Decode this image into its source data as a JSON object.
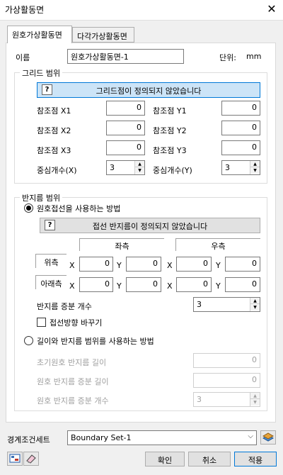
{
  "window": {
    "title": "가상활동면",
    "close_glyph": "✕"
  },
  "tabs": [
    {
      "label": "원호가상활동면",
      "active": true
    },
    {
      "label": "다각가상활동면",
      "active": false
    }
  ],
  "name_row": {
    "label": "이름",
    "value": "원호가상활동면-1",
    "unit_label": "단위:",
    "unit_value": "mm"
  },
  "grid": {
    "group_label": "그리드 범위",
    "banner_text": "그리드점이 정의되지 않았습니다",
    "fields": {
      "x1_label": "참조점 X1",
      "x1_value": "0",
      "y1_label": "참조점 Y1",
      "y1_value": "0",
      "x2_label": "참조점 X2",
      "x2_value": "0",
      "y2_label": "참조점 Y2",
      "y2_value": "0",
      "x3_label": "참조점 X3",
      "x3_value": "0",
      "y3_label": "참조점 Y3",
      "y3_value": "0"
    },
    "center_x_label": "중심개수(X)",
    "center_x_value": "3",
    "center_y_label": "중심개수(Y)",
    "center_y_value": "3"
  },
  "radius": {
    "group_label": "반지름 범위",
    "option1_label": "원호접선을 사용하는 방법",
    "option1_checked": true,
    "banner_text": "접선 반지름이 정의되지 않았습니다",
    "left_header": "좌측",
    "right_header": "우측",
    "upper_label": "위측",
    "lower_label": "아래측",
    "x_letter": "X",
    "y_letter": "Y",
    "upper": {
      "left_x": "0",
      "left_y": "0",
      "right_x": "0",
      "right_y": "0"
    },
    "lower": {
      "left_x": "0",
      "left_y": "0",
      "right_x": "0",
      "right_y": "0"
    },
    "increment_count_label": "반지름 증분 개수",
    "increment_count_value": "3",
    "flip_tangent_label": "접선방향 바꾸기",
    "flip_tangent_checked": false,
    "option2_label": "길이와 반지름 범위를 사용하는 방법",
    "option2_checked": false,
    "initial_radius_label": "초기원호 반지름 길이",
    "initial_radius_value": "0",
    "radius_increment_length_label": "원호 반지름 증분 길이",
    "radius_increment_length_value": "0",
    "radius_increment_count_label": "원호 반지름 증분 개수",
    "radius_increment_count_value": "3"
  },
  "boundary": {
    "label": "경계조건세트",
    "value": "Boundary Set-1"
  },
  "buttons": {
    "ok": "확인",
    "cancel": "취소",
    "apply": "적용"
  },
  "icons": {
    "layers": "layers-icon",
    "image_settings": "image-settings-icon",
    "eraser": "eraser-icon"
  }
}
